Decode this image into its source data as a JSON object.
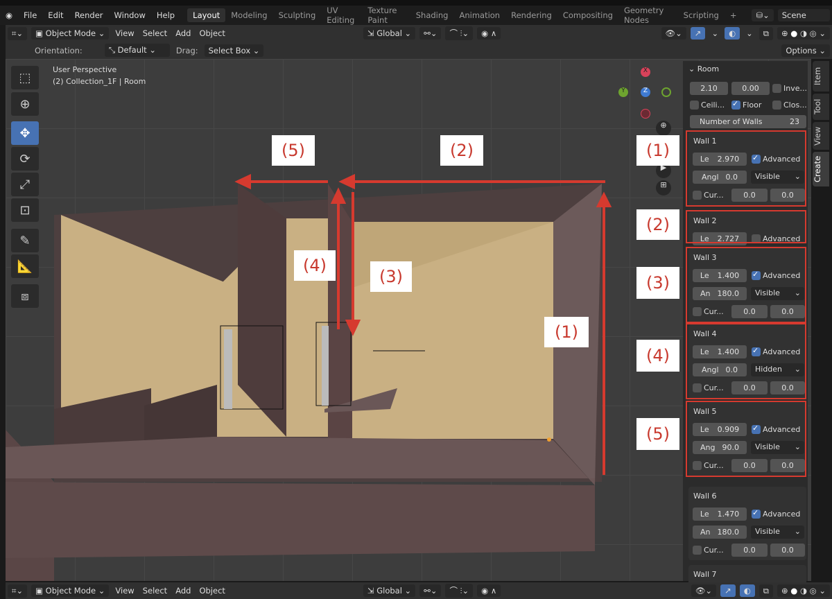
{
  "menu": [
    "File",
    "Edit",
    "Render",
    "Window",
    "Help"
  ],
  "workspaces": [
    "Layout",
    "Modeling",
    "Sculpting",
    "UV Editing",
    "Texture Paint",
    "Shading",
    "Animation",
    "Rendering",
    "Compositing",
    "Geometry Nodes",
    "Scripting"
  ],
  "active_workspace": "Layout",
  "scene": "Scene",
  "header": {
    "mode": "Object Mode",
    "view": "View",
    "select": "Select",
    "add": "Add",
    "object": "Object",
    "transform": "Global"
  },
  "toolsettings": {
    "orientation_label": "Orientation:",
    "orientation": "Default",
    "drag_label": "Drag:",
    "drag": "Select Box",
    "options": "Options"
  },
  "viewport": {
    "perspective": "User Perspective",
    "collection": "(2) Collection_1F | Room"
  },
  "gizmo": {
    "x": "X",
    "y": "Y",
    "z": "Z"
  },
  "tabs": [
    "Item",
    "Tool",
    "View",
    "Create"
  ],
  "room": {
    "title": "Room",
    "height": "2.10",
    "offset": "0.00",
    "invert": "Inve...",
    "ceiling": "Ceili...",
    "floor": "Floor",
    "close": "Clos...",
    "walls_label": "Number of Walls",
    "walls_count": "23"
  },
  "walls": [
    {
      "title": "Wall 1",
      "len_label": "Le",
      "len": "2.970",
      "advanced": true,
      "ang_label": "Angl",
      "ang": "0.0",
      "vis": "Visible",
      "cur": "Cur...",
      "c1": "0.0",
      "c2": "0.0"
    },
    {
      "title": "Wall 2",
      "len_label": "Le",
      "len": "2.727",
      "advanced": false
    },
    {
      "title": "Wall 3",
      "len_label": "Le",
      "len": "1.400",
      "advanced": true,
      "ang_label": "An",
      "ang": "180.0",
      "vis": "Visible",
      "cur": "Cur...",
      "c1": "0.0",
      "c2": "0.0"
    },
    {
      "title": "Wall 4",
      "len_label": "Le",
      "len": "1.400",
      "advanced": true,
      "ang_label": "Angl",
      "ang": "0.0",
      "vis": "Hidden",
      "cur": "Cur...",
      "c1": "0.0",
      "c2": "0.0"
    },
    {
      "title": "Wall 5",
      "len_label": "Le",
      "len": "0.909",
      "advanced": true,
      "ang_label": "Ang",
      "ang": "90.0",
      "vis": "Visible",
      "cur": "Cur...",
      "c1": "0.0",
      "c2": "0.0"
    },
    {
      "title": "Wall 6",
      "len_label": "Le",
      "len": "1.470",
      "advanced": true,
      "ang_label": "An",
      "ang": "180.0",
      "vis": "Visible",
      "cur": "Cur...",
      "c1": "0.0",
      "c2": "0.0"
    },
    {
      "title": "Wall 7"
    }
  ],
  "advanced_label": "Advanced",
  "annotations": [
    "(1)",
    "(2)",
    "(3)",
    "(4)",
    "(5)"
  ],
  "colors": {
    "accent": "#4772b3",
    "annotation": "#d63a2f",
    "wall_face": "#c9b083",
    "wall_dark": "#5a4646"
  }
}
